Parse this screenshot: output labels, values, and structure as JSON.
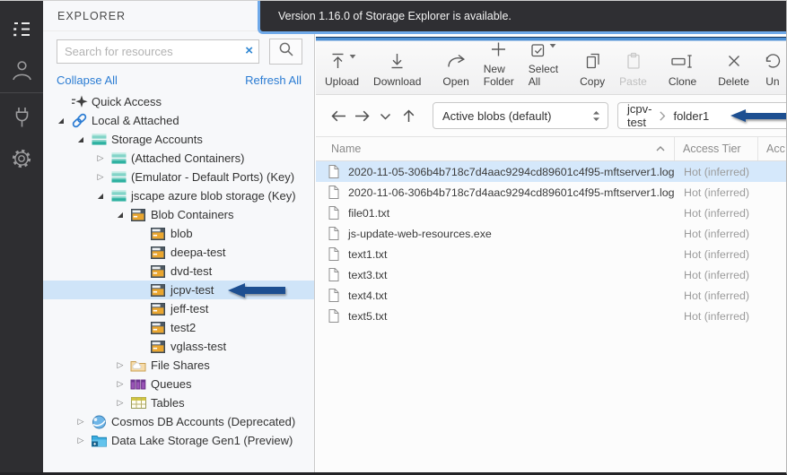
{
  "colors": {
    "accent_blue": "#4e90d4",
    "arrow_blue": "#1d4f91",
    "selection": "#cfe4f8",
    "link_blue": "#2b7cd3",
    "notification_bg": "#2f2f33",
    "activitybar_bg": "#2e2e31"
  },
  "notification": {
    "text": "Version 1.16.0 of Storage Explorer is available."
  },
  "activity_bar": {
    "items": [
      {
        "icon": "explorer-tree-icon",
        "active": true
      },
      {
        "icon": "person-icon",
        "active": false
      },
      {
        "icon": "plug-icon",
        "active": false
      },
      {
        "icon": "gear-icon",
        "active": false
      }
    ]
  },
  "sidebar": {
    "title": "EXPLORER",
    "search": {
      "placeholder": "Search for resources"
    },
    "collapse_all": "Collapse All",
    "refresh_all": "Refresh All",
    "tree": [
      {
        "label": "Quick Access",
        "icon": "quick-access-icon",
        "level": 0,
        "expander": "none"
      },
      {
        "label": "Local & Attached",
        "icon": "link-icon",
        "level": 0,
        "expander": "expanded"
      },
      {
        "label": "Storage Accounts",
        "icon": "storage-accounts-icon",
        "level": 1,
        "expander": "expanded"
      },
      {
        "label": "(Attached Containers)",
        "icon": "storage-accounts-icon",
        "level": 2,
        "expander": "collapsed"
      },
      {
        "label": "(Emulator - Default Ports) (Key)",
        "icon": "storage-accounts-icon",
        "level": 2,
        "expander": "collapsed"
      },
      {
        "label": "jscape azure blob storage (Key)",
        "icon": "storage-accounts-icon",
        "level": 2,
        "expander": "expanded"
      },
      {
        "label": "Blob Containers",
        "icon": "blob-container-icon",
        "level": 3,
        "expander": "expanded"
      },
      {
        "label": "blob",
        "icon": "blob-container-icon",
        "level": 4,
        "expander": "none"
      },
      {
        "label": "deepa-test",
        "icon": "blob-container-icon",
        "level": 4,
        "expander": "none"
      },
      {
        "label": "dvd-test",
        "icon": "blob-container-icon",
        "level": 4,
        "expander": "none"
      },
      {
        "label": "jcpv-test",
        "icon": "blob-container-icon",
        "level": 4,
        "expander": "none",
        "selected": true,
        "annotation_arrow": true
      },
      {
        "label": "jeff-test",
        "icon": "blob-container-icon",
        "level": 4,
        "expander": "none"
      },
      {
        "label": "test2",
        "icon": "blob-container-icon",
        "level": 4,
        "expander": "none"
      },
      {
        "label": "vglass-test",
        "icon": "blob-container-icon",
        "level": 4,
        "expander": "none"
      },
      {
        "label": "File Shares",
        "icon": "file-share-icon",
        "level": 3,
        "expander": "collapsed"
      },
      {
        "label": "Queues",
        "icon": "queue-icon",
        "level": 3,
        "expander": "collapsed"
      },
      {
        "label": "Tables",
        "icon": "table-icon",
        "level": 3,
        "expander": "collapsed"
      },
      {
        "label": "Cosmos DB Accounts (Deprecated)",
        "icon": "cosmos-db-icon",
        "level": 1,
        "expander": "collapsed"
      },
      {
        "label": "Data Lake Storage Gen1 (Preview)",
        "icon": "data-lake-icon",
        "level": 1,
        "expander": "collapsed"
      }
    ]
  },
  "toolbar": {
    "buttons": [
      {
        "label": "Upload",
        "icon": "upload-icon",
        "caret": true
      },
      {
        "label": "Download",
        "icon": "download-icon",
        "separator_after": true
      },
      {
        "label": "Open",
        "icon": "open-icon"
      },
      {
        "label": "New Folder",
        "icon": "new-folder-icon"
      },
      {
        "label": "Select All",
        "icon": "select-all-icon",
        "caret": true,
        "separator_after": true
      },
      {
        "label": "Copy",
        "icon": "copy-icon"
      },
      {
        "label": "Paste",
        "icon": "paste-icon",
        "disabled": true,
        "separator_after": true
      },
      {
        "label": "Clone",
        "icon": "clone-icon",
        "separator_after": true
      },
      {
        "label": "Delete",
        "icon": "delete-icon"
      },
      {
        "label": "Un",
        "icon": "undelete-icon",
        "clipped": true
      }
    ]
  },
  "navbar": {
    "nav_icons": [
      "back-arrow-icon",
      "forward-arrow-icon",
      "chevron-down-icon",
      "up-arrow-icon"
    ],
    "view_select": {
      "value": "Active blobs (default)"
    },
    "breadcrumb": {
      "segments": [
        "jcpv-test",
        "folder1"
      ],
      "annotation_arrow": true
    }
  },
  "table": {
    "columns": [
      {
        "label": "Name",
        "sort": "asc"
      },
      {
        "label": "Access Tier"
      },
      {
        "label": "Acc"
      }
    ],
    "rows": [
      {
        "name": "2020-11-05-306b4b718c7d4aac9294cd89601c4f95-mftserver1.log",
        "access_tier": "Hot (inferred)",
        "selected": true
      },
      {
        "name": "2020-11-06-306b4b718c7d4aac9294cd89601c4f95-mftserver1.log",
        "access_tier": "Hot (inferred)"
      },
      {
        "name": "file01.txt",
        "access_tier": "Hot (inferred)"
      },
      {
        "name": "js-update-web-resources.exe",
        "access_tier": "Hot (inferred)"
      },
      {
        "name": "text1.txt",
        "access_tier": "Hot (inferred)"
      },
      {
        "name": "text3.txt",
        "access_tier": "Hot (inferred)"
      },
      {
        "name": "text4.txt",
        "access_tier": "Hot (inferred)"
      },
      {
        "name": "text5.txt",
        "access_tier": "Hot (inferred)"
      }
    ]
  }
}
